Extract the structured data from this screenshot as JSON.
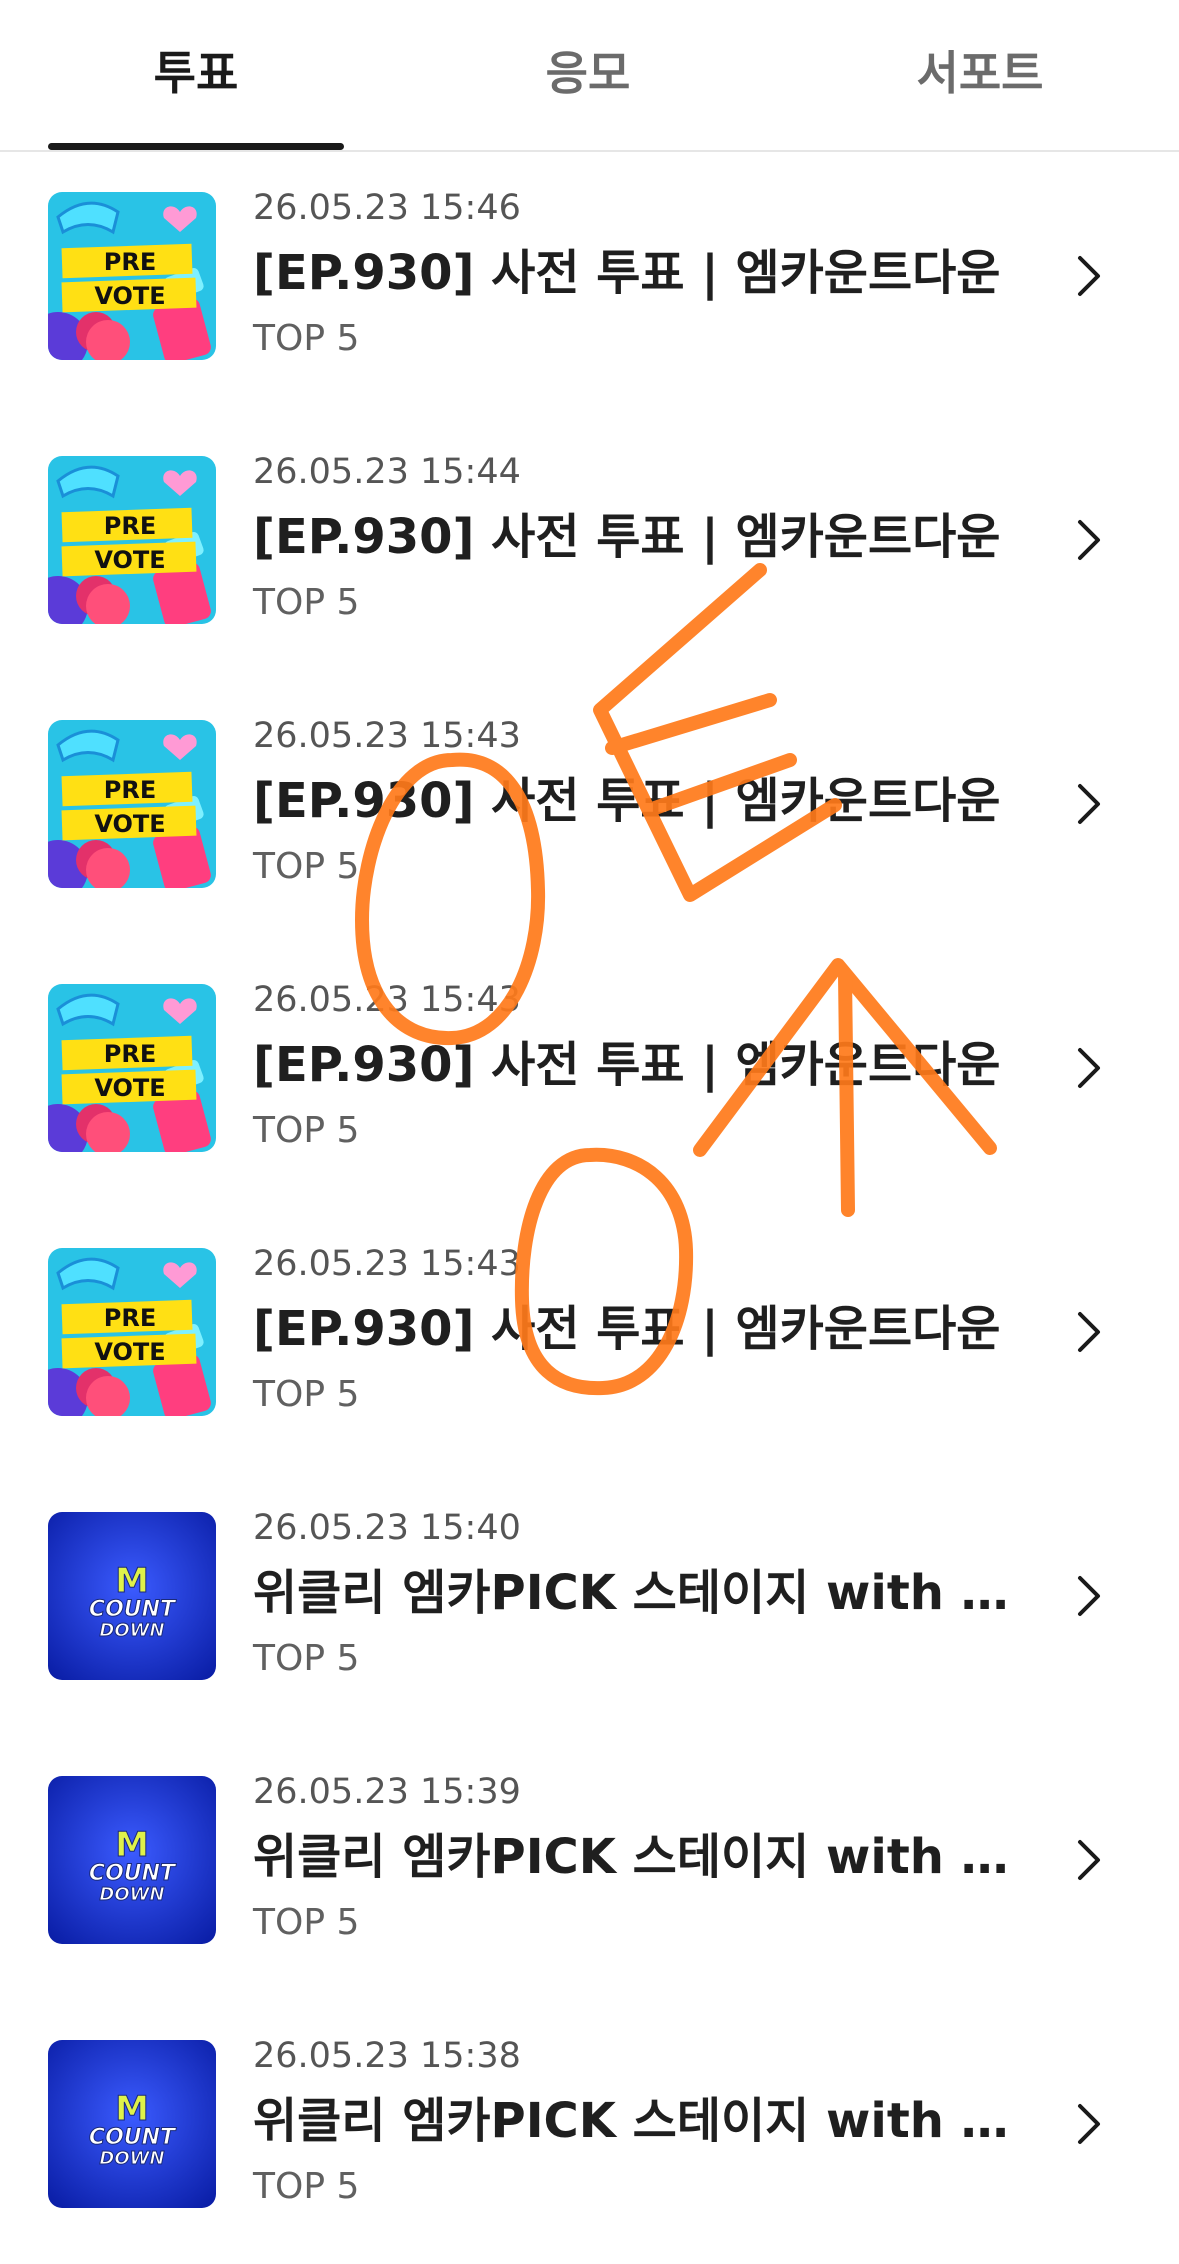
{
  "tabs": [
    {
      "label": "투표",
      "active": true
    },
    {
      "label": "응모",
      "active": false
    },
    {
      "label": "서포트",
      "active": false
    }
  ],
  "items": [
    {
      "date": "26.05.23 15:46",
      "title": "[EP.930] 사전 투표 | 엠카운트다운",
      "sub": "TOP 5",
      "thumb": "prevote",
      "thumb_text": [
        "PRE",
        "VOTE"
      ]
    },
    {
      "date": "26.05.23 15:44",
      "title": "[EP.930] 사전 투표 | 엠카운트다운",
      "sub": "TOP 5",
      "thumb": "prevote",
      "thumb_text": [
        "PRE",
        "VOTE"
      ]
    },
    {
      "date": "26.05.23 15:43",
      "title": "[EP.930] 사전 투표 | 엠카운트다운",
      "sub": "TOP 5",
      "thumb": "prevote",
      "thumb_text": [
        "PRE",
        "VOTE"
      ]
    },
    {
      "date": "26.05.23 15:43",
      "title": "[EP.930] 사전 투표 | 엠카운트다운",
      "sub": "TOP 5",
      "thumb": "prevote",
      "thumb_text": [
        "PRE",
        "VOTE"
      ]
    },
    {
      "date": "26.05.23 15:43",
      "title": "[EP.930] 사전 투표 | 엠카운트다운",
      "sub": "TOP 5",
      "thumb": "prevote",
      "thumb_text": [
        "PRE",
        "VOTE"
      ]
    },
    {
      "date": "26.05.23 15:40",
      "title": "위클리 엠카PICK 스테이지 with KUR...",
      "sub": "TOP 5",
      "thumb": "countdown",
      "thumb_text": [
        "M",
        "COUNT",
        "DOWN"
      ]
    },
    {
      "date": "26.05.23 15:39",
      "title": "위클리 엠카PICK 스테이지 with KUR...",
      "sub": "TOP 5",
      "thumb": "countdown",
      "thumb_text": [
        "M",
        "COUNT",
        "DOWN"
      ]
    },
    {
      "date": "26.05.23 15:38",
      "title": "위클리 엠카PICK 스테이지 with KUR...",
      "sub": "TOP 5",
      "thumb": "countdown",
      "thumb_text": [
        "M",
        "COUNT",
        "DOWN"
      ]
    }
  ],
  "icons": {
    "row_arrow": "chevron-right-icon"
  },
  "colors": {
    "scribble": "#ff7a1a",
    "tab_indicator": "#1a1a1a"
  }
}
